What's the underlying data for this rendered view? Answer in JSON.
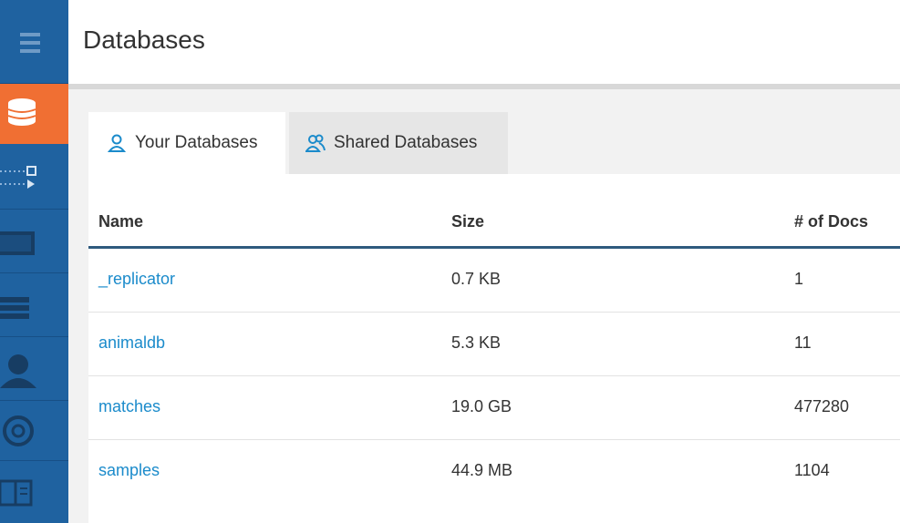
{
  "page": {
    "title": "Databases"
  },
  "tabs": [
    {
      "label": "Your Databases",
      "icon": "user-icon",
      "active": true
    },
    {
      "label": "Shared Databases",
      "icon": "users-icon",
      "active": false
    }
  ],
  "table": {
    "headers": {
      "name": "Name",
      "size": "Size",
      "docs": "# of Docs"
    },
    "rows": [
      {
        "name": "_replicator",
        "size": "0.7 KB",
        "docs": "1"
      },
      {
        "name": "animaldb",
        "size": "5.3 KB",
        "docs": "11"
      },
      {
        "name": "matches",
        "size": "19.0 GB",
        "docs": "477280"
      },
      {
        "name": "samples",
        "size": "44.9 MB",
        "docs": "1104"
      }
    ]
  },
  "sidebar": {
    "items": [
      {
        "icon": "menu-icon"
      },
      {
        "icon": "database-icon",
        "active": true
      },
      {
        "icon": "replication-icon"
      },
      {
        "icon": "monitor-icon"
      },
      {
        "icon": "list-icon"
      },
      {
        "icon": "user-icon"
      },
      {
        "icon": "lifebuoy-icon"
      },
      {
        "icon": "book-icon"
      }
    ]
  },
  "colors": {
    "sidebar": "#1f62a0",
    "sidebar_active": "#f06f33",
    "link": "#1b8bcb",
    "header_rule": "#2e5a7e"
  }
}
